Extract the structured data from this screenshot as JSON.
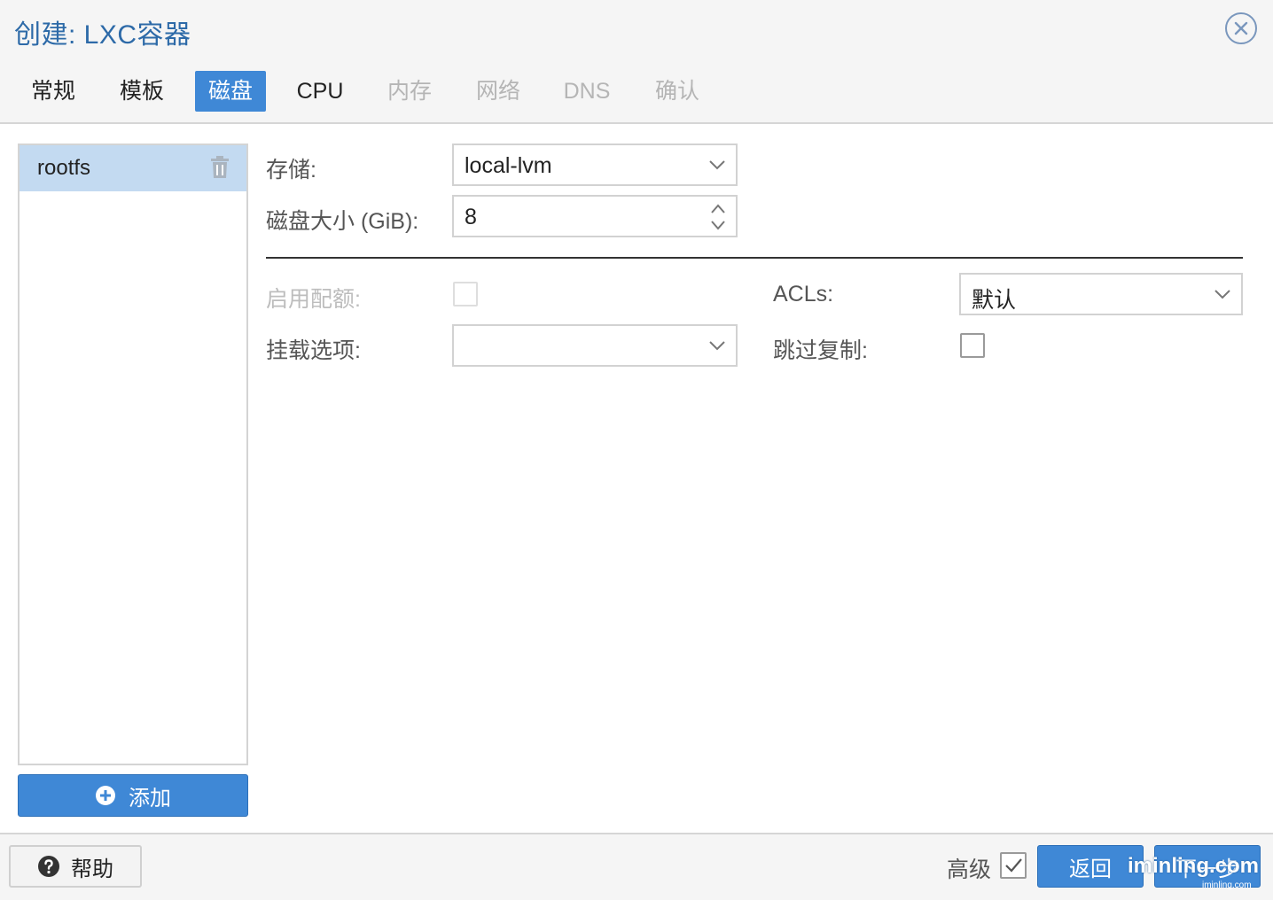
{
  "window": {
    "title": "创建: LXC容器",
    "close_icon": "close-icon"
  },
  "tabs": [
    {
      "label": "常规",
      "state": "enabled"
    },
    {
      "label": "模板",
      "state": "enabled"
    },
    {
      "label": "磁盘",
      "state": "active"
    },
    {
      "label": "CPU",
      "state": "enabled"
    },
    {
      "label": "内存",
      "state": "disabled"
    },
    {
      "label": "网络",
      "state": "disabled"
    },
    {
      "label": "DNS",
      "state": "disabled"
    },
    {
      "label": "确认",
      "state": "disabled"
    }
  ],
  "disks": {
    "items": [
      {
        "label": "rootfs",
        "icon": "trash-icon"
      }
    ],
    "add_label": "添加",
    "add_icon": "plus-circle-icon"
  },
  "form": {
    "storage": {
      "label": "存储:",
      "value": "local-lvm"
    },
    "disk_size": {
      "label": "磁盘大小 (GiB):",
      "value": "8"
    },
    "quota": {
      "label": "启用配额:",
      "checked": false,
      "disabled": true
    },
    "mount_options": {
      "label": "挂载选项:",
      "value": ""
    },
    "acls": {
      "label": "ACLs:",
      "value": "默认"
    },
    "skip_replication": {
      "label": "跳过复制:",
      "checked": false
    }
  },
  "footer": {
    "help_label": "帮助",
    "help_icon": "question-circle-icon",
    "advanced_label": "高级",
    "advanced_checked": true,
    "back_label": "返回",
    "next_label": "下一步",
    "watermark": "iminling.com",
    "watermark_small": "iminling.com"
  },
  "colors": {
    "accent": "#3f88d6",
    "title": "#2d6aa8",
    "selected_row": "#c3daf1"
  }
}
